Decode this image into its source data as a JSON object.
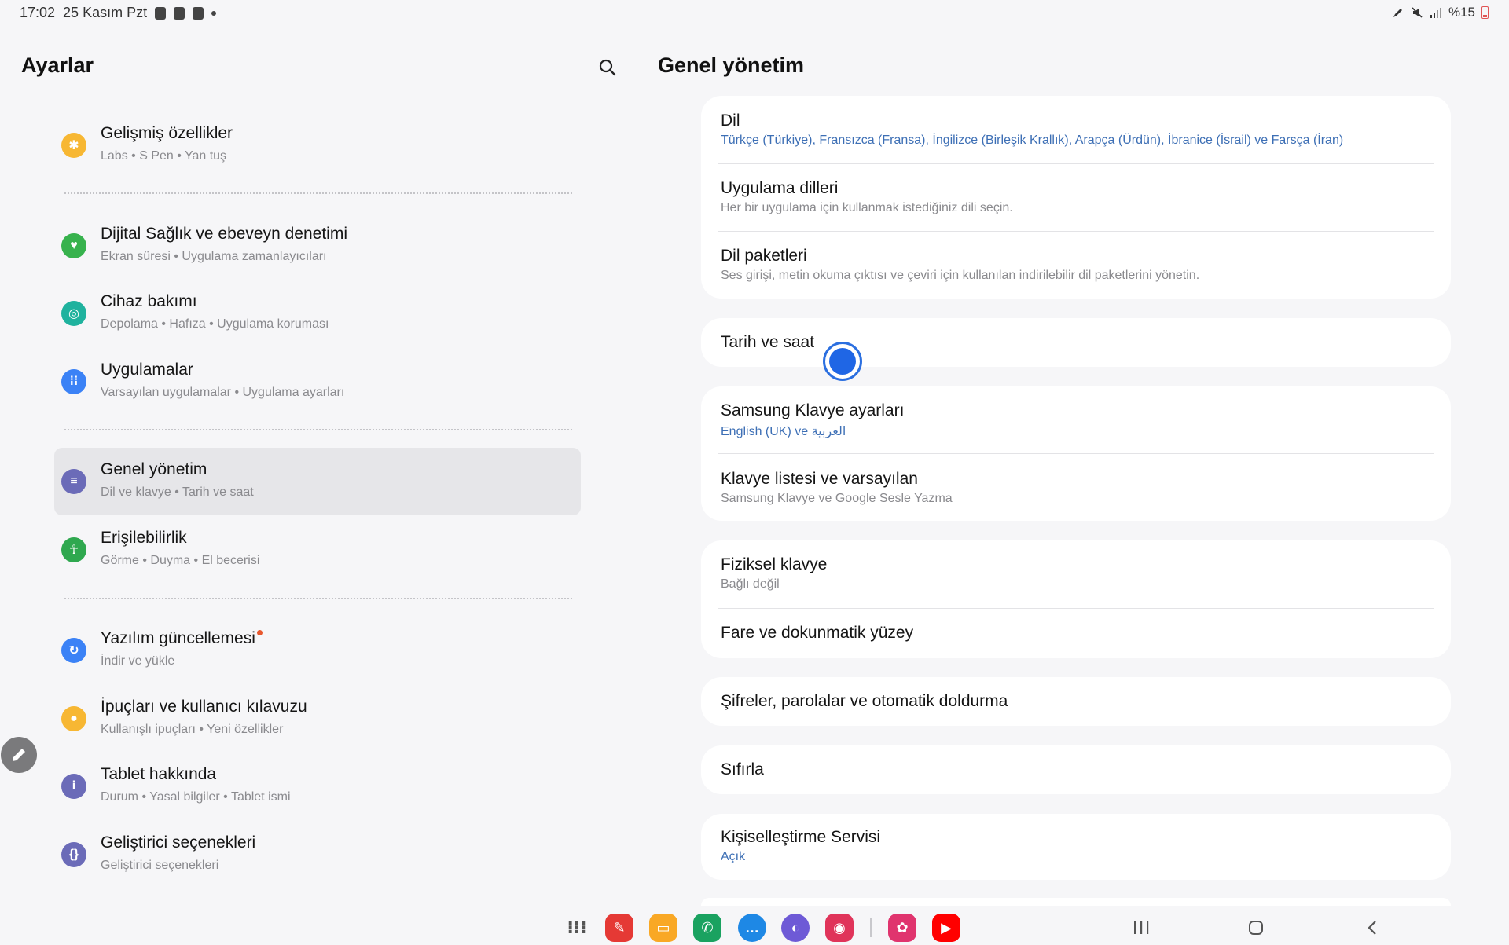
{
  "status_bar": {
    "time": "17:02",
    "date": "25 Kasım Pzt",
    "battery": "%15",
    "icons_left": [
      "sim-icon",
      "gallery-icon",
      "checkbox-icon",
      "dot-icon"
    ],
    "icons_right": [
      "pen-icon",
      "mute-icon",
      "signal-icon",
      "battery-icon"
    ]
  },
  "left_panel": {
    "title": "Ayarlar",
    "search_icon": "search-icon",
    "items": [
      {
        "title": "Gelişmiş özellikler",
        "subtitle": "Labs  •  S Pen  •  Yan tuş",
        "icon": "star-gear-icon",
        "color": "#f7b733"
      },
      {
        "title": "Dijital Sağlık ve ebeveyn denetimi",
        "subtitle": "Ekran süresi  •  Uygulama zamanlayıcıları",
        "icon": "heart-icon",
        "color": "#37b24d"
      },
      {
        "title": "Cihaz bakımı",
        "subtitle": "Depolama  •  Hafıza  •  Uygulama koruması",
        "icon": "device-care-icon",
        "color": "#1fb29e"
      },
      {
        "title": "Uygulamalar",
        "subtitle": "Varsayılan uygulamalar  •  Uygulama ayarları",
        "icon": "apps-grid-icon",
        "color": "#3b82f6"
      },
      {
        "title": "Genel yönetim",
        "subtitle": "Dil ve klavye  •  Tarih ve saat",
        "icon": "sliders-icon",
        "color": "#6b6bb8",
        "active": true
      },
      {
        "title": "Erişilebilirlik",
        "subtitle": "Görme  •  Duyma  •  El becerisi",
        "icon": "accessibility-icon",
        "color": "#2fa84f"
      },
      {
        "title": "Yazılım güncellemesi",
        "subtitle": "İndir ve yükle",
        "icon": "update-icon",
        "color": "#3b82f6",
        "badge": true
      },
      {
        "title": "İpuçları ve kullanıcı kılavuzu",
        "subtitle": "Kullanışlı ipuçları  •  Yeni özellikler",
        "icon": "lightbulb-icon",
        "color": "#f7b733"
      },
      {
        "title": "Tablet hakkında",
        "subtitle": "Durum  •  Yasal bilgiler  •  Tablet ismi",
        "icon": "info-icon",
        "color": "#6b6bb8"
      },
      {
        "title": "Geliştirici seçenekleri",
        "subtitle": "Geliştirici seçenekleri",
        "icon": "braces-icon",
        "color": "#6b6bb8"
      }
    ]
  },
  "right_panel": {
    "title": "Genel yönetim",
    "cards": [
      {
        "rows": [
          {
            "title": "Dil",
            "subtitle": "Türkçe (Türkiye), Fransızca (Fransa), İngilizce (Birleşik Krallık), Arapça (Ürdün), İbranice (İsrail) ve Farsça (İran)",
            "subtitle_blue": true
          },
          {
            "title": "Uygulama dilleri",
            "subtitle": "Her bir uygulama için kullanmak istediğiniz dili seçin."
          },
          {
            "title": "Dil paketleri",
            "subtitle": "Ses girişi, metin okuma çıktısı ve çeviri için kullanılan indirilebilir dil paketlerini yönetin."
          }
        ]
      },
      {
        "rows": [
          {
            "title": "Tarih ve saat"
          }
        ]
      },
      {
        "rows": [
          {
            "title": "Samsung Klavye ayarları",
            "subtitle": "English (UK) ve العربية",
            "subtitle_blue": true
          },
          {
            "title": "Klavye listesi ve varsayılan",
            "subtitle": "Samsung Klavye ve Google Sesle Yazma"
          }
        ]
      },
      {
        "rows": [
          {
            "title": "Fiziksel klavye",
            "subtitle": "Bağlı değil"
          },
          {
            "title": "Fare ve dokunmatik yüzey"
          }
        ]
      },
      {
        "rows": [
          {
            "title": "Şifreler, parolalar ve otomatik doldurma"
          }
        ]
      },
      {
        "rows": [
          {
            "title": "Sıfırla"
          }
        ]
      },
      {
        "rows": [
          {
            "title": "Kişiselleştirme Servisi",
            "subtitle": "Açık",
            "subtitle_blue": true
          }
        ]
      }
    ]
  },
  "taskbar": {
    "apps": [
      {
        "name": "apps-drawer-icon"
      },
      {
        "name": "notes-app-icon",
        "color": "#e53935"
      },
      {
        "name": "files-app-icon",
        "color": "#f9a825"
      },
      {
        "name": "phone-app-icon",
        "color": "#1aa260"
      },
      {
        "name": "messages-app-icon",
        "color": "#1e88e5"
      },
      {
        "name": "internet-app-icon",
        "color": "#6e5ad6"
      },
      {
        "name": "camera-app-icon",
        "color": "#e0345a"
      },
      {
        "name": "gallery-app-icon",
        "color": "#e0346e"
      },
      {
        "name": "youtube-app-icon",
        "color": "#ff0000"
      }
    ],
    "nav": [
      "recents-icon",
      "home-icon",
      "back-icon"
    ]
  }
}
